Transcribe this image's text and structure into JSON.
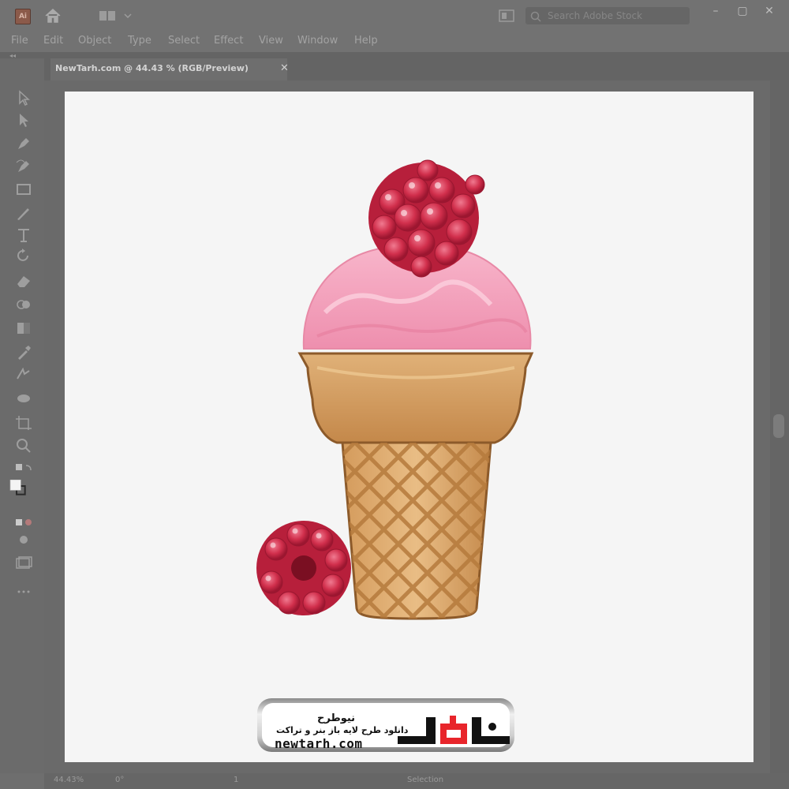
{
  "app": {
    "logo_text": "Ai"
  },
  "search": {
    "placeholder": "Search Adobe Stock"
  },
  "window_controls": {
    "minimize": "–",
    "maximize": "▢",
    "close": "✕"
  },
  "menu": [
    "File",
    "Edit",
    "Object",
    "Type",
    "Select",
    "Effect",
    "View",
    "Window",
    "Help"
  ],
  "document": {
    "tab_title": "NewTarh.com @ 44.43 % (RGB/Preview)",
    "close": "✕"
  },
  "status": {
    "zoom": "44.43%",
    "rotation": "0°",
    "artboard": "1",
    "mode": "Selection"
  },
  "tools": [
    "selection-tool-icon",
    "direct-selection-tool-icon",
    "pen-tool-icon",
    "curvature-tool-icon",
    "rectangle-tool-icon",
    "paintbrush-tool-icon",
    "type-tool-icon",
    "rotate-tool-icon",
    "eraser-tool-icon",
    "shape-builder-tool-icon",
    "gradient-tool-icon",
    "eyedropper-tool-icon",
    "blend-tool-icon",
    "symbol-sprayer-tool-icon",
    "artboard-tool-icon",
    "zoom-tool-icon"
  ],
  "watermark": {
    "brand_fa": "نیوطرح",
    "tagline_fa": "دانلود طرح لایه باز بنر و تراکت",
    "url": "newtarh.com",
    "brand_mark": "نیوطرح"
  },
  "colors": {
    "accent_red": "#e8252b",
    "raspberry": "#c8243e",
    "ice_cream": "#f4a3bd",
    "cone": "#c98a45"
  }
}
